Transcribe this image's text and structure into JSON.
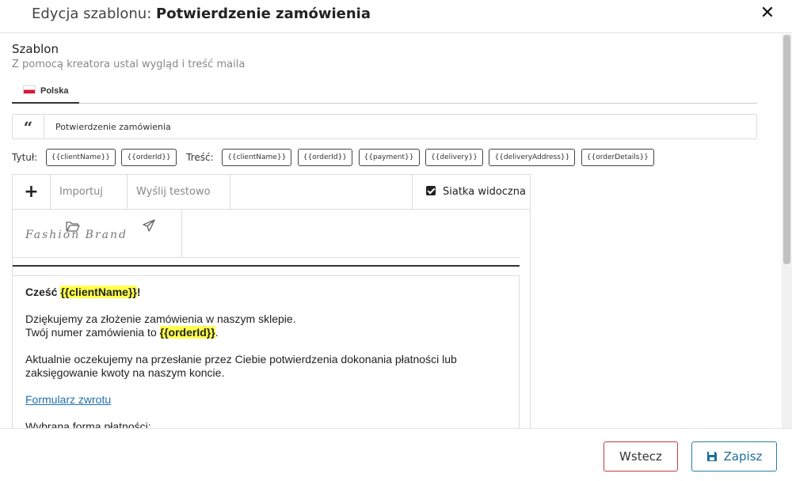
{
  "header": {
    "title_prefix": "Edycja szablonu:",
    "title_name": "Potwierdzenie zamówienia",
    "close_icon": "close-icon"
  },
  "section": {
    "title": "Szablon",
    "subtitle": "Z pomocą kreatora ustal wygląd i treść maila"
  },
  "lang_tabs": [
    {
      "label": "Polska",
      "icon": "flag-poland-icon"
    }
  ],
  "subject": {
    "value": "Potwierdzenie zamówienia",
    "icon": "quote-icon"
  },
  "tags": {
    "title_label": "Tytuł:",
    "title_tags": [
      "{{clientName}}",
      "{{orderId}}"
    ],
    "content_label": "Treść:",
    "content_tags": [
      "{{clientName}}",
      "{{orderId}}",
      "{{payment}}",
      "{{delivery}}",
      "{{deliveryAddress}}",
      "{{orderDetails}}"
    ]
  },
  "toolbar": {
    "add_icon": "plus-icon",
    "import_label": "Importuj",
    "import_icon": "folder-open-icon",
    "send_test_label": "Wyślij testowo",
    "send_test_icon": "paper-plane-icon",
    "grid_label": "Siatka widoczna",
    "grid_checked": true
  },
  "mail": {
    "logo_text": "Fashion Brand",
    "greeting": "Cześć",
    "greeting_tag": "{{clientName}}",
    "greeting_end": "!",
    "thanks_line": "Dziękujemy za złożenie zamówienia w naszym sklepie.",
    "order_line": "Twój numer zamówienia to",
    "order_tag": "{{orderId}}",
    "order_end": ".",
    "waiting_text": "Aktualnie oczekujemy na przesłanie przez Ciebie potwierdzenia dokonania płatności lub zaksięgowanie kwoty na naszym koncie.",
    "return_link": "Formularz zwrotu",
    "payment_label": "Wybrana forma płatności:"
  },
  "footer": {
    "back_label": "Wstecz",
    "save_label": "Zapisz",
    "save_icon": "floppy-disk-icon"
  },
  "colors": {
    "highlight": "#ffff4d",
    "back_border": "#c93b3b",
    "save_border": "#2a7fa8",
    "link": "#1f6fb0"
  }
}
